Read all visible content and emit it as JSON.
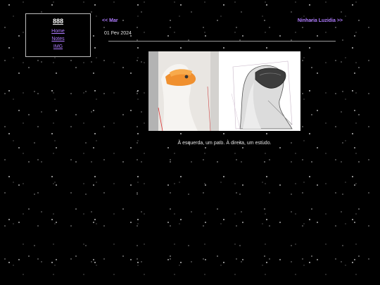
{
  "sidebar": {
    "site_title": "888",
    "nav": [
      {
        "label": "Home"
      },
      {
        "label": "Notes"
      },
      {
        "label": "IMG"
      }
    ]
  },
  "post": {
    "prev_label": "<< Mar",
    "next_label": "Ninharia Luzidia >>",
    "date": "01 Fev 2024",
    "caption": "À esquerda, um pato. À direita, um estudo."
  },
  "colors": {
    "background": "#000000",
    "link": "#b07cff",
    "text": "#e6e6e6"
  }
}
